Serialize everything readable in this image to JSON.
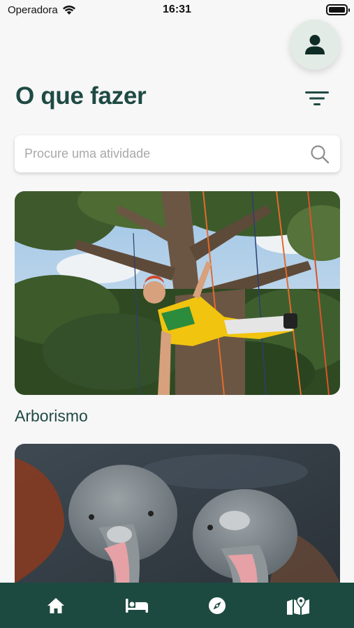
{
  "status_bar": {
    "carrier": "Operadora",
    "time": "16:31",
    "icons": [
      "wifi-icon",
      "battery-icon"
    ]
  },
  "header": {
    "title": "O que fazer",
    "profile_icon": "user-icon",
    "filter_icon": "filter-icon"
  },
  "search": {
    "placeholder": "Procure uma atividade",
    "value": "",
    "icon": "search-icon"
  },
  "activities": [
    {
      "title": "Arborismo",
      "image": "tree-climbing-photo"
    },
    {
      "title": "",
      "image": "pink-river-dolphins-photo"
    }
  ],
  "bottom_nav": {
    "items": [
      {
        "icon": "home-icon"
      },
      {
        "icon": "bed-icon"
      },
      {
        "icon": "compass-icon"
      },
      {
        "icon": "map-icon"
      }
    ]
  },
  "colors": {
    "primary": "#1f4a43",
    "nav_background": "#1c4a40",
    "profile_background": "#e2ebe6",
    "page_background": "#f7f7f7"
  }
}
